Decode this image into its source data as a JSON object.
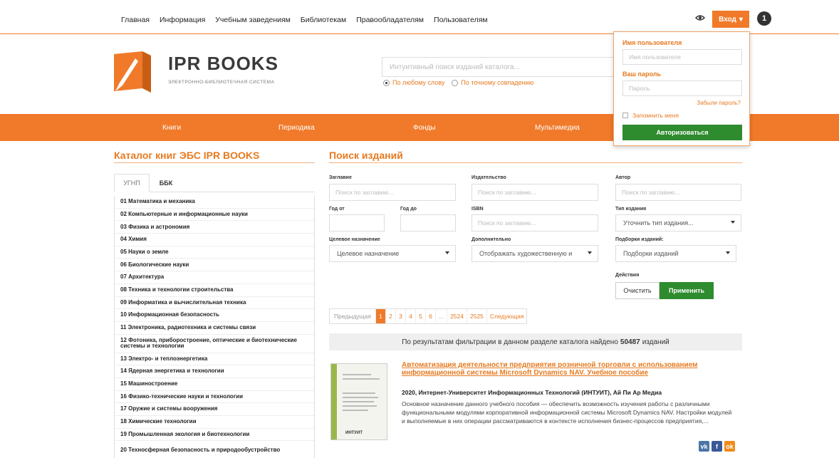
{
  "topnav": {
    "links": [
      "Главная",
      "Информация",
      "Учебным заведениям",
      "Библиотекам",
      "Правообладателям",
      "Пользователям"
    ],
    "login_label": "Вход",
    "badge": "1"
  },
  "brand": {
    "title": "IPR BOOKS",
    "subtitle": "ЭЛЕКТРОННО-БИБЛИОТЕЧНАЯ СИСТЕМА",
    "accent_color": "#f07a2a"
  },
  "search": {
    "placeholder": "Интуитивный поиск изданий каталога...",
    "radio_any": "По любому слову",
    "radio_exact": "По точному совпадению"
  },
  "menu": [
    "Книги",
    "Периодика",
    "Фонды",
    "Мультимедиа"
  ],
  "login_panel": {
    "username_label": "Имя пользователя",
    "username_placeholder": "Имя пользователя",
    "password_label": "Ваш пароль",
    "password_placeholder": "Пароль",
    "forgot": "Забыли пароль?",
    "remember": "Запомнить меня",
    "submit": "Авторизоваться"
  },
  "catalog": {
    "title": "Каталог книг ЭБС IPR BOOKS",
    "tabs": [
      "УГНП",
      "ББК"
    ],
    "items": [
      "01 Математика и механика",
      "02 Компьютерные и информационные науки",
      "03 Физика и астрономия",
      "04 Химия",
      "05 Науки о земле",
      "06 Биологические науки",
      "07 Архитектура",
      "08 Техника и технологии строительства",
      "09 Информатика и вычислительная техника",
      "10 Информационная безопасность",
      "11 Электроника, радиотехника и системы связи",
      "12 Фотоника, приборостроение, оптические и биотехнические системы и технологии",
      "13 Электро- и теплоэнергетика",
      "14 Ядерная энергетика и технологии",
      "15 Машиностроение",
      "16 Физико-технические науки и технологии",
      "17 Оружие и системы вооружения",
      "18 Химические технологии",
      "19 Промышленная экология и биотехнологии",
      "20 Техносферная безопасность и природообустройство"
    ]
  },
  "filters": {
    "title": "Поиск изданий",
    "title_label": "Заглавие",
    "title_placeholder": "Поиск по заглавию...",
    "publisher_label": "Издательство",
    "publisher_placeholder": "Поиск по заглавию...",
    "author_label": "Автор",
    "author_placeholder": "Поиск по заглавию...",
    "year_from_label": "Год от",
    "year_to_label": "Год до",
    "isbn_label": "ISBN",
    "isbn_placeholder": "Поиск по заглавию...",
    "type_label": "Тип издания",
    "type_value": "Уточнить тип издания...",
    "purpose_label": "Целевое назначение",
    "purpose_value": "Целевое назначение",
    "extra_label": "Дополнительно",
    "extra_value": "Отображать художественную и",
    "collections_label": "Подборки изданий:",
    "collections_value": "Подборки изданий",
    "actions_label": "Действия",
    "clear": "Очистить",
    "apply": "Применить"
  },
  "pager": {
    "prev": "Предыдущая",
    "pages": [
      "1",
      "2",
      "3",
      "4",
      "5",
      "6",
      "...",
      "2524",
      "2525"
    ],
    "next": "Следующая",
    "active": "1"
  },
  "results": {
    "prefix": "По результатам фильтрации в данном разделе каталога найдено",
    "count": "50487",
    "suffix": "изданий"
  },
  "book": {
    "title": "Автоматизация деятельности предприятия розничной торговли с использованием информационной системы Microsoft Dynamics NAV. Учебное пособие",
    "meta": "2020, Интернет-Университет Информационных Технологий (ИНТУИТ), Ай Пи Ар Медиа",
    "description": "Основное назначение данного учебного пособия — обеспечить возможность изучения работы с различными функциональными модулями корпоративной информационной системы Microsoft Dynamics NAV. Настройки модулей и выполняемые в них операции рассматриваются в контексте исполнения бизнес-процессов предприятия,...",
    "cover_publisher": "ИНТУИТ"
  },
  "share": {
    "vk": "vk",
    "fb": "f",
    "ok": "ok"
  }
}
